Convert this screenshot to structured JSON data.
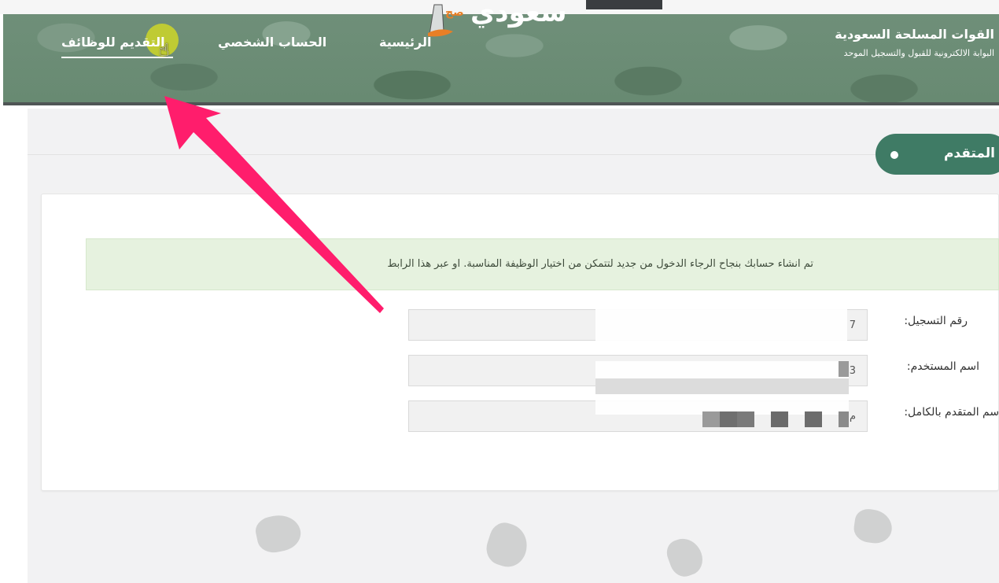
{
  "watermark": {
    "logo_text": "سعودي",
    "logo_sub": "صح"
  },
  "header": {
    "title": "القوات المسلحة السعودية",
    "subtitle": "البوابة الالكترونية للقبول والتسجيل الموحد",
    "nav": {
      "home": "الرئيسية",
      "profile": "الحساب الشخصي",
      "apply": "التقديم للوظائف"
    }
  },
  "section": {
    "title": "المتقدم"
  },
  "alert": {
    "message": "تم انشاء حسابك بنجاح الرجاء الدخول من جديد لتتمكن من اختيار الوظيفة المناسبة. او عبر هذا الرابط"
  },
  "form": {
    "registration_number": {
      "label": "رقم التسجيل:",
      "value": "7"
    },
    "username": {
      "label": "اسم المستخدم:",
      "value": "3"
    },
    "full_name": {
      "label": "اسم المتقدم بالكامل:",
      "value": "م"
    }
  },
  "colors": {
    "header_green": "#6f8f79",
    "pill_green": "#3f7b65",
    "alert_bg": "#e6f2df",
    "arrow_pink": "#ff1d6c",
    "cursor_halo": "#ced628"
  },
  "icons": {
    "cursor": "pointer-hand-icon",
    "arrow": "annotation-arrow-icon"
  }
}
